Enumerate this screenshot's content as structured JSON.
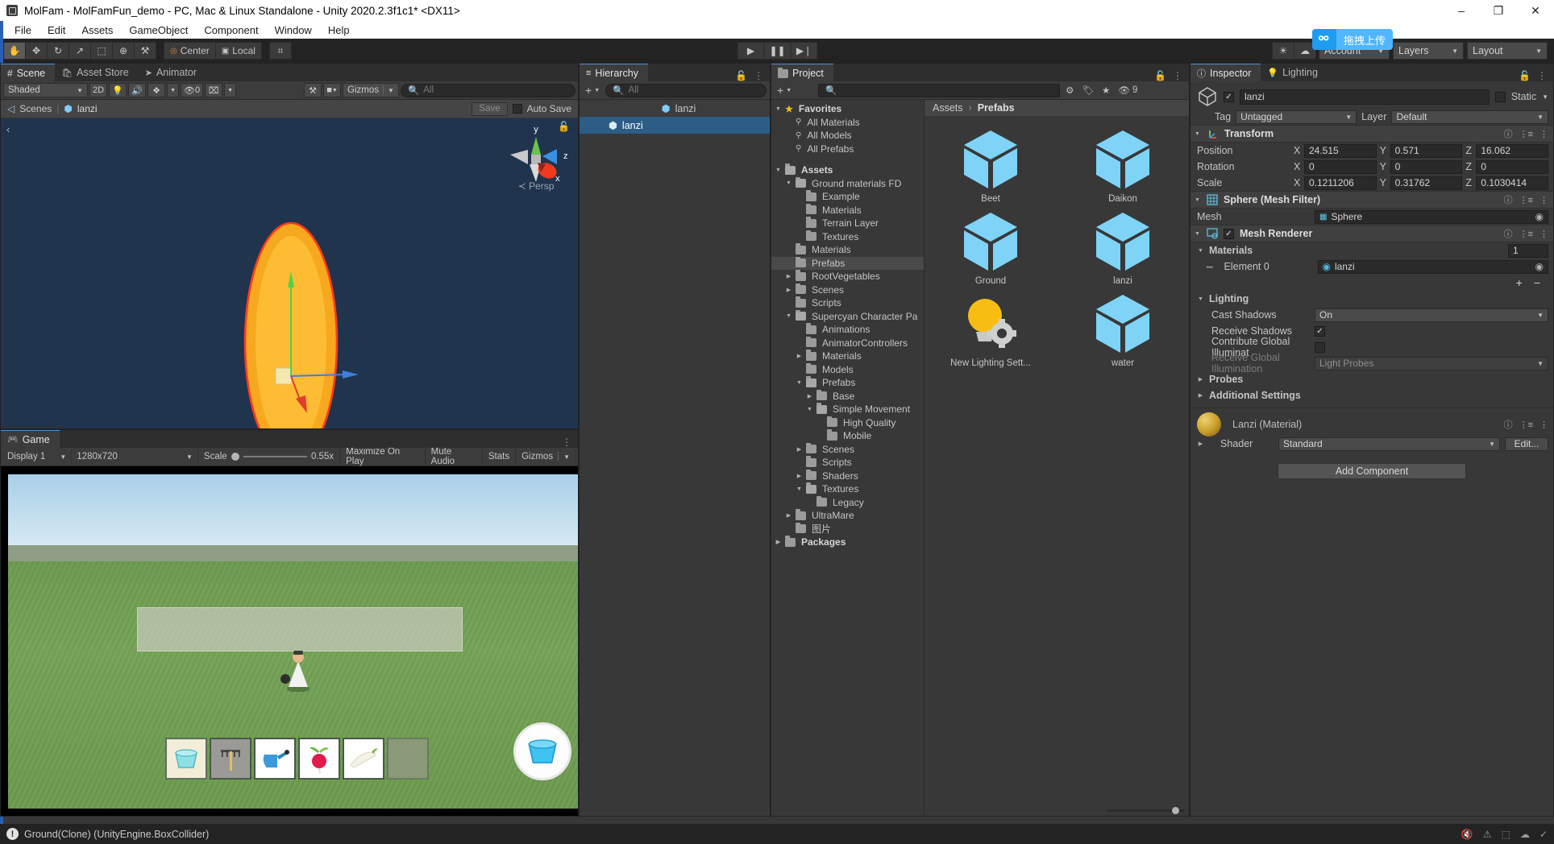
{
  "window": {
    "title": "MolFam - MolFamFun_demo - PC, Mac & Linux Standalone - Unity 2020.2.3f1c1* <DX11>",
    "minimize": "–",
    "maximize": "❐",
    "close": "✕"
  },
  "menu": {
    "items": [
      "File",
      "Edit",
      "Assets",
      "GameObject",
      "Component",
      "Window",
      "Help"
    ]
  },
  "toolbar": {
    "tools": [
      {
        "name": "hand-tool",
        "glyph": "✋"
      },
      {
        "name": "move-tool",
        "glyph": "✥"
      },
      {
        "name": "rotate-tool",
        "glyph": "↻"
      },
      {
        "name": "scale-tool",
        "glyph": "↗"
      },
      {
        "name": "rect-tool",
        "glyph": "⬚"
      },
      {
        "name": "transform-tool",
        "glyph": "⊕"
      },
      {
        "name": "custom-tool",
        "glyph": "⚒"
      }
    ],
    "pivot_mode": "Center",
    "pivot_rotation": "Local",
    "grid_snap_glyph": "⌗",
    "play": "▶",
    "pause": "❚❚",
    "step": "▶❘",
    "collab_glyph": "☀",
    "cloud_glyph": "☁",
    "account": "Account",
    "layers": "Layers",
    "layout": "Layout",
    "upload_badge": {
      "icon": "∞",
      "text": "拖拽上传"
    }
  },
  "scene": {
    "tabs": [
      {
        "label": "Scene",
        "icon": "#",
        "selected": true
      },
      {
        "label": "Asset Store",
        "icon": "🛍",
        "selected": false
      },
      {
        "label": "Animator",
        "icon": "➤",
        "selected": false
      }
    ],
    "shading_mode": "Shaded",
    "mode_2d": "2D",
    "light_glyph": "💡",
    "audio_glyph": "🔊",
    "fx_glyph": "❖",
    "hidden_count": "0",
    "grid_glyph": "⌗",
    "tools_glyph": "⚒",
    "camera_glyph": "■",
    "gizmos": "Gizmos",
    "search_placeholder": "All",
    "breadcrumb": [
      "Scenes",
      "lanzi"
    ],
    "save_label": "Save",
    "autosave_label": "Auto Save",
    "gizmo_axes": {
      "y": "y",
      "x": "x",
      "z": "z"
    },
    "perspective_label": "Persp"
  },
  "game": {
    "tab_label": "Game",
    "display": "Display 1",
    "resolution": "1280x720",
    "scale_label": "Scale",
    "scale_value": "0.55x",
    "maximize_on_play": "Maximize On Play",
    "mute_audio": "Mute Audio",
    "stats": "Stats",
    "gizmos": "Gizmos",
    "inventory_items": [
      {
        "name": "basket",
        "selected": true
      },
      {
        "name": "rake",
        "selected": false
      },
      {
        "name": "watering-can",
        "selected": false
      },
      {
        "name": "radish",
        "selected": false
      },
      {
        "name": "daikon",
        "selected": false
      },
      {
        "name": "empty-slot",
        "selected": false
      }
    ]
  },
  "hierarchy": {
    "tab_label": "Hierarchy",
    "add_label": "+",
    "search_placeholder": "All",
    "scene_header": "lanzi",
    "items": [
      {
        "label": "lanzi",
        "selected": true,
        "depth": 1
      }
    ]
  },
  "project": {
    "tab_label": "Project",
    "add_label": "+",
    "search_placeholder": "",
    "icon_counter": "9",
    "breadcrumb": [
      "Assets",
      "Prefabs"
    ],
    "tree": [
      {
        "label": "Favorites",
        "indent": 0,
        "tri": "▼",
        "kind": "star",
        "bold": true
      },
      {
        "label": "All Materials",
        "indent": 1,
        "tri": "",
        "kind": "search"
      },
      {
        "label": "All Models",
        "indent": 1,
        "tri": "",
        "kind": "search"
      },
      {
        "label": "All Prefabs",
        "indent": 1,
        "tri": "",
        "kind": "search"
      },
      {
        "label": "",
        "indent": 0,
        "tri": "",
        "kind": "spacer"
      },
      {
        "label": "Assets",
        "indent": 0,
        "tri": "▼",
        "kind": "folder-open",
        "bold": true
      },
      {
        "label": "Ground materials FD",
        "indent": 1,
        "tri": "▼",
        "kind": "folder-open"
      },
      {
        "label": "Example",
        "indent": 2,
        "tri": "",
        "kind": "folder"
      },
      {
        "label": "Materials",
        "indent": 2,
        "tri": "",
        "kind": "folder"
      },
      {
        "label": "Terrain Layer",
        "indent": 2,
        "tri": "",
        "kind": "folder"
      },
      {
        "label": "Textures",
        "indent": 2,
        "tri": "",
        "kind": "folder"
      },
      {
        "label": "Materials",
        "indent": 1,
        "tri": "",
        "kind": "folder"
      },
      {
        "label": "Prefabs",
        "indent": 1,
        "tri": "",
        "kind": "folder",
        "selected": true
      },
      {
        "label": "RootVegetables",
        "indent": 1,
        "tri": "▶",
        "kind": "folder"
      },
      {
        "label": "Scenes",
        "indent": 1,
        "tri": "▶",
        "kind": "folder"
      },
      {
        "label": "Scripts",
        "indent": 1,
        "tri": "",
        "kind": "folder"
      },
      {
        "label": "Supercyan Character Pa",
        "indent": 1,
        "tri": "▼",
        "kind": "folder-open"
      },
      {
        "label": "Animations",
        "indent": 2,
        "tri": "",
        "kind": "folder"
      },
      {
        "label": "AnimatorControllers",
        "indent": 2,
        "tri": "",
        "kind": "folder"
      },
      {
        "label": "Materials",
        "indent": 2,
        "tri": "▶",
        "kind": "folder"
      },
      {
        "label": "Models",
        "indent": 2,
        "tri": "",
        "kind": "folder"
      },
      {
        "label": "Prefabs",
        "indent": 2,
        "tri": "▼",
        "kind": "folder-open"
      },
      {
        "label": "Base",
        "indent": 3,
        "tri": "▶",
        "kind": "folder"
      },
      {
        "label": "Simple Movement",
        "indent": 3,
        "tri": "▼",
        "kind": "folder-open"
      },
      {
        "label": "High Quality",
        "indent": 4,
        "tri": "",
        "kind": "folder"
      },
      {
        "label": "Mobile",
        "indent": 4,
        "tri": "",
        "kind": "folder"
      },
      {
        "label": "Scenes",
        "indent": 2,
        "tri": "▶",
        "kind": "folder"
      },
      {
        "label": "Scripts",
        "indent": 2,
        "tri": "",
        "kind": "folder"
      },
      {
        "label": "Shaders",
        "indent": 2,
        "tri": "▶",
        "kind": "folder"
      },
      {
        "label": "Textures",
        "indent": 2,
        "tri": "▼",
        "kind": "folder-open"
      },
      {
        "label": "Legacy",
        "indent": 3,
        "tri": "",
        "kind": "folder"
      },
      {
        "label": "UltraMare",
        "indent": 1,
        "tri": "▶",
        "kind": "folder"
      },
      {
        "label": "图片",
        "indent": 1,
        "tri": "",
        "kind": "folder"
      },
      {
        "label": "Packages",
        "indent": 0,
        "tri": "▶",
        "kind": "folder",
        "bold": true
      }
    ],
    "assets": [
      {
        "label": "Beet",
        "icon": "prefab-cube"
      },
      {
        "label": "Daikon",
        "icon": "prefab-cube"
      },
      {
        "label": "Ground",
        "icon": "prefab-cube"
      },
      {
        "label": "lanzi",
        "icon": "prefab-cube"
      },
      {
        "label": "New Lighting Sett...",
        "icon": "lighting-settings"
      },
      {
        "label": "water",
        "icon": "prefab-cube"
      }
    ]
  },
  "inspector": {
    "tabs": [
      {
        "label": "Inspector",
        "icon": "ℹ",
        "selected": true
      },
      {
        "label": "Lighting",
        "icon": "💡",
        "selected": false
      }
    ],
    "object_name": "lanzi",
    "object_enabled": true,
    "static_label": "Static",
    "tag_label": "Tag",
    "tag_value": "Untagged",
    "layer_label": "Layer",
    "layer_value": "Default",
    "transform": {
      "title": "Transform",
      "rows": [
        {
          "label": "Position",
          "x": "24.515",
          "y": "0.571",
          "z": "16.062"
        },
        {
          "label": "Rotation",
          "x": "0",
          "y": "0",
          "z": "0"
        },
        {
          "label": "Scale",
          "x": "0.1211206",
          "y": "0.31762",
          "z": "0.1030414"
        }
      ]
    },
    "mesh_filter": {
      "title": "Sphere (Mesh Filter)",
      "mesh_label": "Mesh",
      "mesh_value": "Sphere"
    },
    "mesh_renderer": {
      "title": "Mesh Renderer",
      "enabled": true,
      "materials_label": "Materials",
      "materials_count": "1",
      "element_label": "Element 0",
      "element_value": "lanzi",
      "add_label": "+",
      "remove_label": "−",
      "lighting_label": "Lighting",
      "cast_shadows_label": "Cast Shadows",
      "cast_shadows_value": "On",
      "receive_shadows_label": "Receive Shadows",
      "receive_shadows_checked": true,
      "contribute_gi_label": "Contribute Global Illuminat",
      "contribute_gi_checked": false,
      "receive_gi_label": "Receive Global Illumination",
      "receive_gi_value": "Light Probes",
      "probes_label": "Probes",
      "additional_settings_label": "Additional Settings"
    },
    "material": {
      "title": "Lanzi (Material)",
      "shader_label": "Shader",
      "shader_value": "Standard",
      "edit_label": "Edit..."
    },
    "add_component_label": "Add Component"
  },
  "status": {
    "message": "Ground(Clone) (UnityEngine.BoxCollider)",
    "icons": [
      "🔇",
      "⚠",
      "⬚",
      "☁",
      "✓"
    ]
  },
  "colors": {
    "accent_blue": "#4d90d8",
    "selection_blue": "#2c5d87",
    "prefab_blue": "#7ecdf5",
    "panel_bg": "#383838",
    "panel_dark": "#2e2e2e",
    "gold": "#f0b726"
  }
}
